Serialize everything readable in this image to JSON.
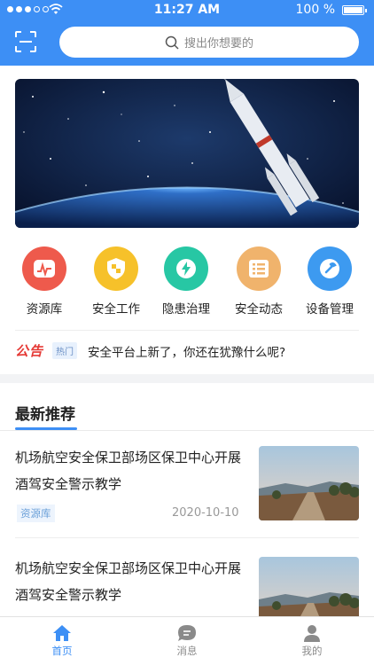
{
  "status_bar": {
    "time": "11:27 AM",
    "battery": "100 %"
  },
  "search": {
    "placeholder": "搜出你想要的"
  },
  "categories": [
    {
      "label": "资源库",
      "icon": "chart-icon",
      "color": "#ee5a4c"
    },
    {
      "label": "安全工作",
      "icon": "shield-icon",
      "color": "#f6c12a"
    },
    {
      "label": "隐患治理",
      "icon": "lightning-icon",
      "color": "#27c7a4"
    },
    {
      "label": "安全动态",
      "icon": "list-icon",
      "color": "#f0b36c"
    },
    {
      "label": "设备管理",
      "icon": "wrench-icon",
      "color": "#3d9af0"
    }
  ],
  "notice": {
    "logo": "公告",
    "tag": "热门",
    "text": "安全平台上新了，你还在犹豫什么呢?"
  },
  "section": {
    "title": "最新推荐"
  },
  "articles": [
    {
      "title": "机场航空安全保卫部场区保卫中心开展酒驾安全警示教学",
      "tag": "资源库",
      "date": "2020-10-10"
    },
    {
      "title": "机场航空安全保卫部场区保卫中心开展酒驾安全警示教学"
    }
  ],
  "tabs": [
    {
      "label": "首页",
      "icon": "home-icon",
      "active": true
    },
    {
      "label": "消息",
      "icon": "message-icon",
      "active": false
    },
    {
      "label": "我的",
      "icon": "user-icon",
      "active": false
    }
  ],
  "colors": {
    "primary": "#3d8ff5",
    "inactive": "#8a8a8a"
  }
}
